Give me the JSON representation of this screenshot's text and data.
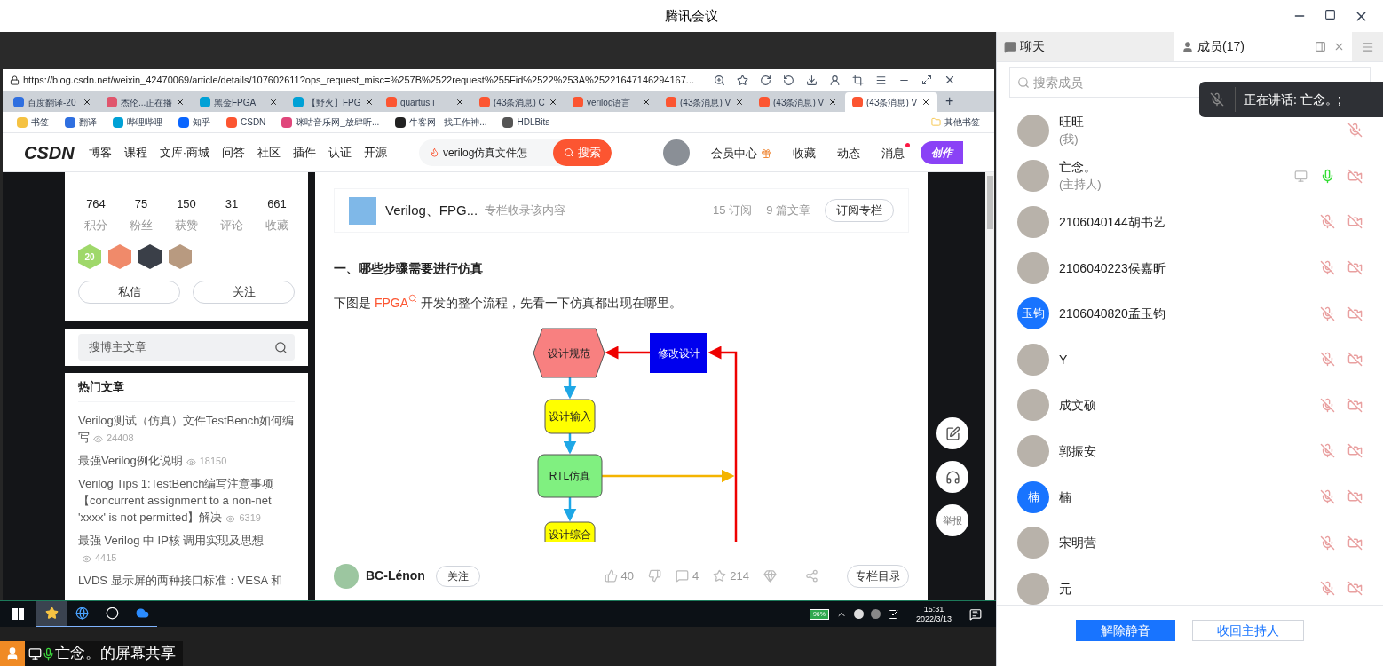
{
  "window": {
    "title": "腾讯会议"
  },
  "browser": {
    "url": "https://blog.csdn.net/weixin_42470069/article/details/107602611?ops_request_misc=%257B%2522request%255Fid%2522%253A%25221647146294167...",
    "tabs": [
      {
        "label": "百度翻译-20",
        "color": "#2f6fe0",
        "selected": false
      },
      {
        "label": "杰伦...正在播",
        "color": "#e0566d",
        "selected": false
      },
      {
        "label": "黑金FPGA_",
        "color": "#00a1d6",
        "selected": false
      },
      {
        "label": "【野火】FPG",
        "color": "#00a1d6",
        "selected": false
      },
      {
        "label": "quartus i",
        "color": "#fc5531",
        "selected": false
      },
      {
        "label": "(43条消息) C",
        "color": "#fc5531",
        "selected": false
      },
      {
        "label": "verilog语言",
        "color": "#fc5531",
        "selected": false
      },
      {
        "label": "(43条消息) V",
        "color": "#fc5531",
        "selected": false
      },
      {
        "label": "(43条消息) V",
        "color": "#fc5531",
        "selected": false
      },
      {
        "label": "(43条消息) V",
        "color": "#fc5531",
        "selected": true
      }
    ],
    "new_tab": "+",
    "bookmarks": [
      {
        "label": "书签",
        "color": "#f5c242"
      },
      {
        "label": "翻译",
        "color": "#2f6fe0"
      },
      {
        "label": "哔哩哔哩",
        "color": "#00a1d6"
      },
      {
        "label": "知乎",
        "color": "#0a66ff"
      },
      {
        "label": "CSDN",
        "color": "#fc5531"
      },
      {
        "label": "咪咕音乐网_放肆听...",
        "color": "#e0467b"
      },
      {
        "label": "牛客网 - 找工作神...",
        "color": "#222222"
      },
      {
        "label": "HDLBits",
        "color": "#555555"
      }
    ],
    "other_bookmarks": "其他书签"
  },
  "csdn": {
    "logo": "CSDN",
    "nav": [
      "博客",
      "课程",
      "文库·商城",
      "问答",
      "社区",
      "插件",
      "认证",
      "开源"
    ],
    "search": {
      "value": "verilog仿真文件怎",
      "button": "搜索"
    },
    "links": [
      {
        "label": "会员中心",
        "kind": "gift"
      },
      {
        "label": "收藏",
        "kind": "plain"
      },
      {
        "label": "动态",
        "kind": "plain"
      },
      {
        "label": "消息",
        "kind": "notify"
      }
    ],
    "create_button": "创作"
  },
  "sidebar": {
    "stats": [
      {
        "value": "764",
        "label": "积分"
      },
      {
        "value": "75",
        "label": "粉丝"
      },
      {
        "value": "150",
        "label": "获赞"
      },
      {
        "value": "31",
        "label": "评论"
      },
      {
        "value": "661",
        "label": "收藏"
      }
    ],
    "badges": [
      {
        "color": "#9fd86a",
        "label": "20"
      },
      {
        "color": "#f08a6a"
      },
      {
        "color": "#3a3f48"
      },
      {
        "color": "#b89a80"
      }
    ],
    "buttons": [
      "私信",
      "关注"
    ],
    "search_placeholder": "搜博主文章",
    "hot_title": "热门文章",
    "articles": [
      {
        "title": "Verilog测试（仿真）文件TestBench如何编写",
        "views": "24408"
      },
      {
        "title": "最强Verilog例化说明",
        "views": "18150"
      },
      {
        "title": "Verilog Tips 1:TestBench编写注意事项【concurrent assignment to a non-net 'xxxx' is not permitted】解决",
        "views": "6319"
      },
      {
        "title": "最强 Verilog 中 IP核 调用实现及思想",
        "views": "4415"
      },
      {
        "title": "LVDS 显示屏的两种接口标准：VESA 和"
      }
    ]
  },
  "article": {
    "column": {
      "title": "Verilog、FPG...",
      "note": "专栏收录该内容",
      "subscribers": "15 订阅",
      "count": "9 篇文章",
      "button": "订阅专栏"
    },
    "heading": "一、哪些步骤需要进行仿真",
    "paragraph": {
      "before": "下图是 ",
      "link": "FPGA",
      "after": " 开发的整个流程，先看一下仿真都出现在哪里。"
    },
    "flowchart": [
      {
        "label": "设计规范",
        "kind": "hexagon",
        "color": "#f88080"
      },
      {
        "label": "修改设计",
        "kind": "box",
        "color": "#0000ee"
      },
      {
        "label": "设计输入",
        "kind": "rounded",
        "color": "#ffff00"
      },
      {
        "label": "RTL仿真",
        "kind": "rounded",
        "color": "#80f080"
      },
      {
        "label": "设计综合",
        "kind": "rounded",
        "color": "#ffff00"
      }
    ],
    "footer": {
      "author": "BC-Lénon",
      "follow": "关注",
      "likes": "40",
      "comments": "4",
      "stars": "214",
      "catalog": "专栏目录"
    },
    "report": "举报"
  },
  "taskbar": {
    "apps": [
      {
        "kind": "star",
        "selected": true
      },
      {
        "kind": "globe",
        "selected": false
      },
      {
        "kind": "circle",
        "selected": false
      },
      {
        "kind": "cloud",
        "selected": false
      }
    ],
    "battery": "96%",
    "time": "15:31",
    "date": "2022/3/13"
  },
  "share_caption": "亡念。的屏幕共享",
  "panel": {
    "tabs": [
      {
        "label": "聊天",
        "kind": "chat",
        "selected": false
      },
      {
        "label": "成员(17)",
        "kind": "members",
        "selected": true
      }
    ],
    "search_placeholder": "搜索成员",
    "toast": "正在讲话: 亡念。;",
    "members": [
      {
        "name": "旺旺",
        "role": "(我)",
        "mic_on": false,
        "camera_off": false,
        "sharing": false
      },
      {
        "name": "亡念。",
        "role": "(主持人)",
        "mic_on": true,
        "camera_off": true,
        "sharing": true
      },
      {
        "name": "2106040144胡书艺",
        "mic_on": false,
        "camera_off": true,
        "sharing": false
      },
      {
        "name": "2106040223侯嘉昕",
        "mic_on": false,
        "camera_off": true,
        "sharing": false
      },
      {
        "name": "2106040820孟玉钧",
        "initial": "玉钧",
        "mic_on": false,
        "camera_off": true,
        "sharing": false
      },
      {
        "name": "Y",
        "mic_on": false,
        "camera_off": true,
        "sharing": false
      },
      {
        "name": "成文硕",
        "mic_on": false,
        "camera_off": true,
        "sharing": false
      },
      {
        "name": "郭振安",
        "mic_on": false,
        "camera_off": true,
        "sharing": false
      },
      {
        "name": "楠",
        "initial": "楠",
        "mic_on": false,
        "camera_off": true,
        "sharing": false
      },
      {
        "name": "宋明营",
        "mic_on": false,
        "camera_off": true,
        "sharing": false
      },
      {
        "name": "元",
        "mic_on": false,
        "camera_off": true,
        "sharing": false
      }
    ],
    "buttons": [
      {
        "label": "解除静音",
        "kind": "primary"
      },
      {
        "label": "收回主持人",
        "kind": "outline"
      }
    ]
  }
}
